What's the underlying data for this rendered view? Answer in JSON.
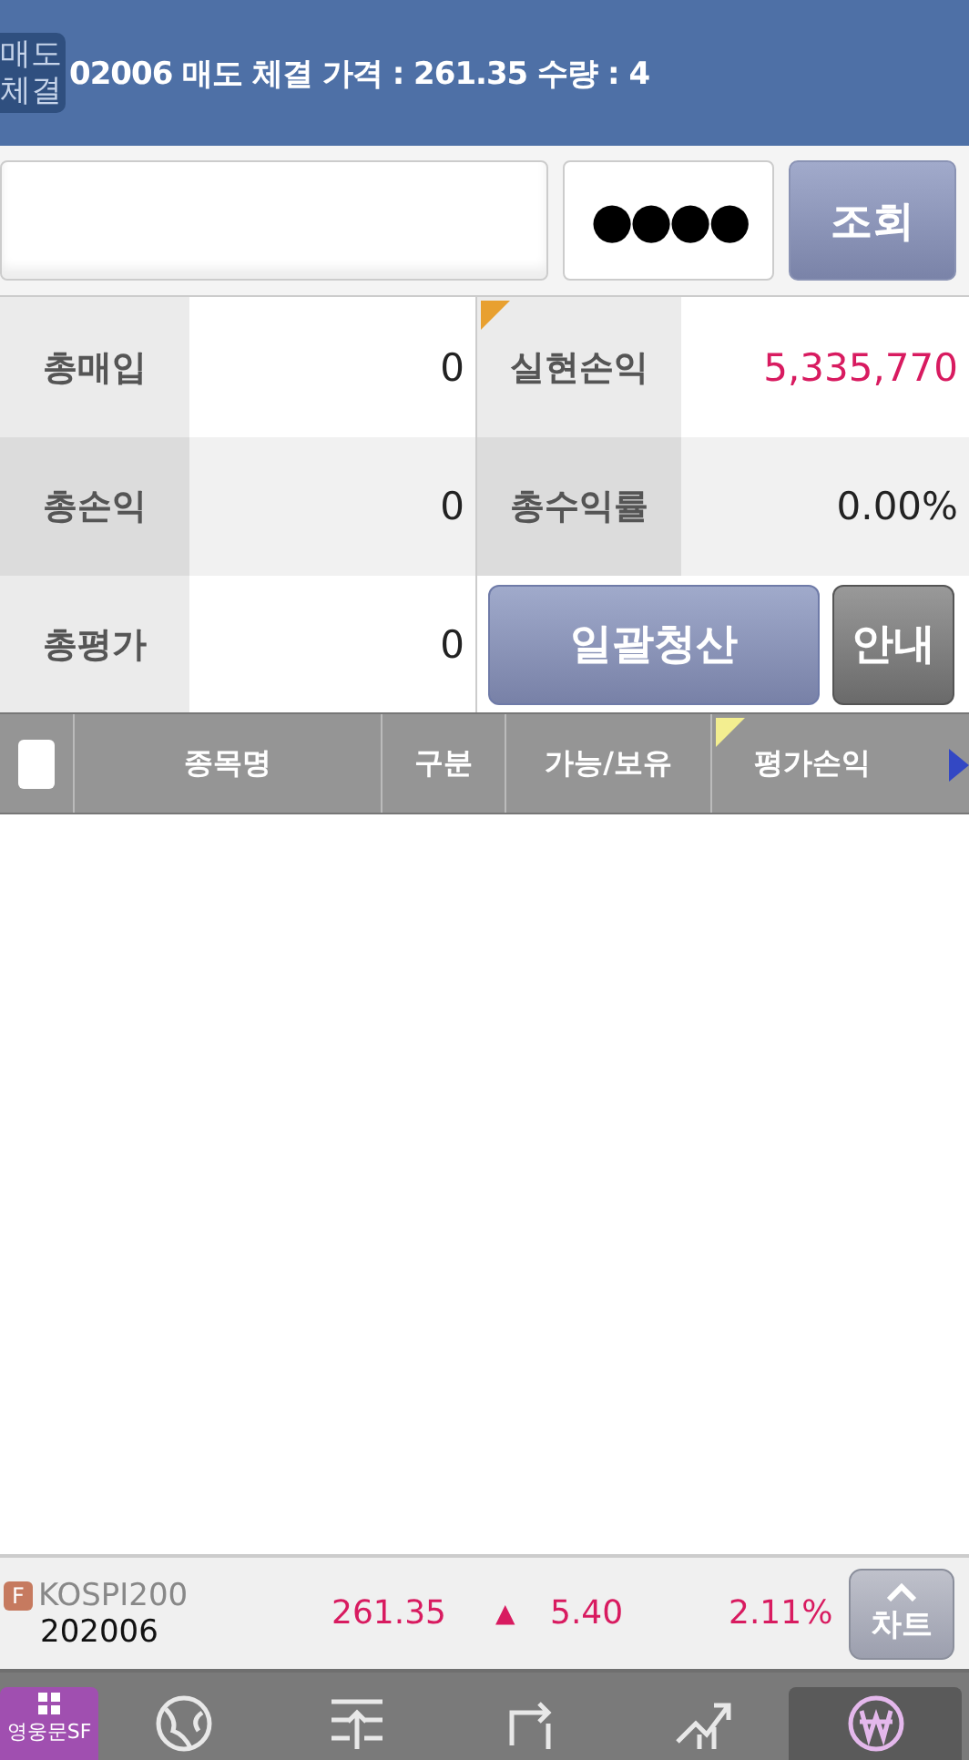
{
  "notice": {
    "badge": [
      "매도",
      "체결"
    ],
    "text": "02006 매도 체결 가격 : 261.35 수량 : 4"
  },
  "query": {
    "password": "●●●●",
    "button": "조회"
  },
  "summary": [
    {
      "label": "총매입",
      "value": "0",
      "flag": false,
      "color": "#222222"
    },
    {
      "label": "실현손익",
      "value": "5,335,770",
      "flag": true,
      "color": "#d81b60"
    },
    {
      "label": "총손익",
      "value": "0",
      "flag": false,
      "color": "#222222"
    },
    {
      "label": "총수익률",
      "value": "0.00%",
      "flag": false,
      "color": "#222222"
    },
    {
      "label": "총평가",
      "value": "0",
      "flag": false,
      "color": "#222222"
    }
  ],
  "actions": [
    {
      "label": "일괄청산",
      "kind": "primary"
    },
    {
      "label": "안내",
      "kind": "secondary"
    }
  ],
  "table": {
    "checked": false,
    "columns": [
      {
        "label": "종목명",
        "flag": false
      },
      {
        "label": "구분",
        "flag": false
      },
      {
        "label": "가능/보유",
        "flag": false
      },
      {
        "label": "평가손익",
        "flag": true
      }
    ]
  },
  "ticker": {
    "badge": "F",
    "name": "KOSPI200",
    "code": "202006",
    "price": "261.35",
    "arrow": "▲",
    "change": "5.40",
    "rate": "2.11%",
    "button": "차트"
  },
  "nav": {
    "logo": "영웅문SF",
    "items": [
      {
        "selected": false
      },
      {
        "selected": false
      },
      {
        "selected": false
      },
      {
        "selected": false
      },
      {
        "selected": true
      }
    ]
  }
}
